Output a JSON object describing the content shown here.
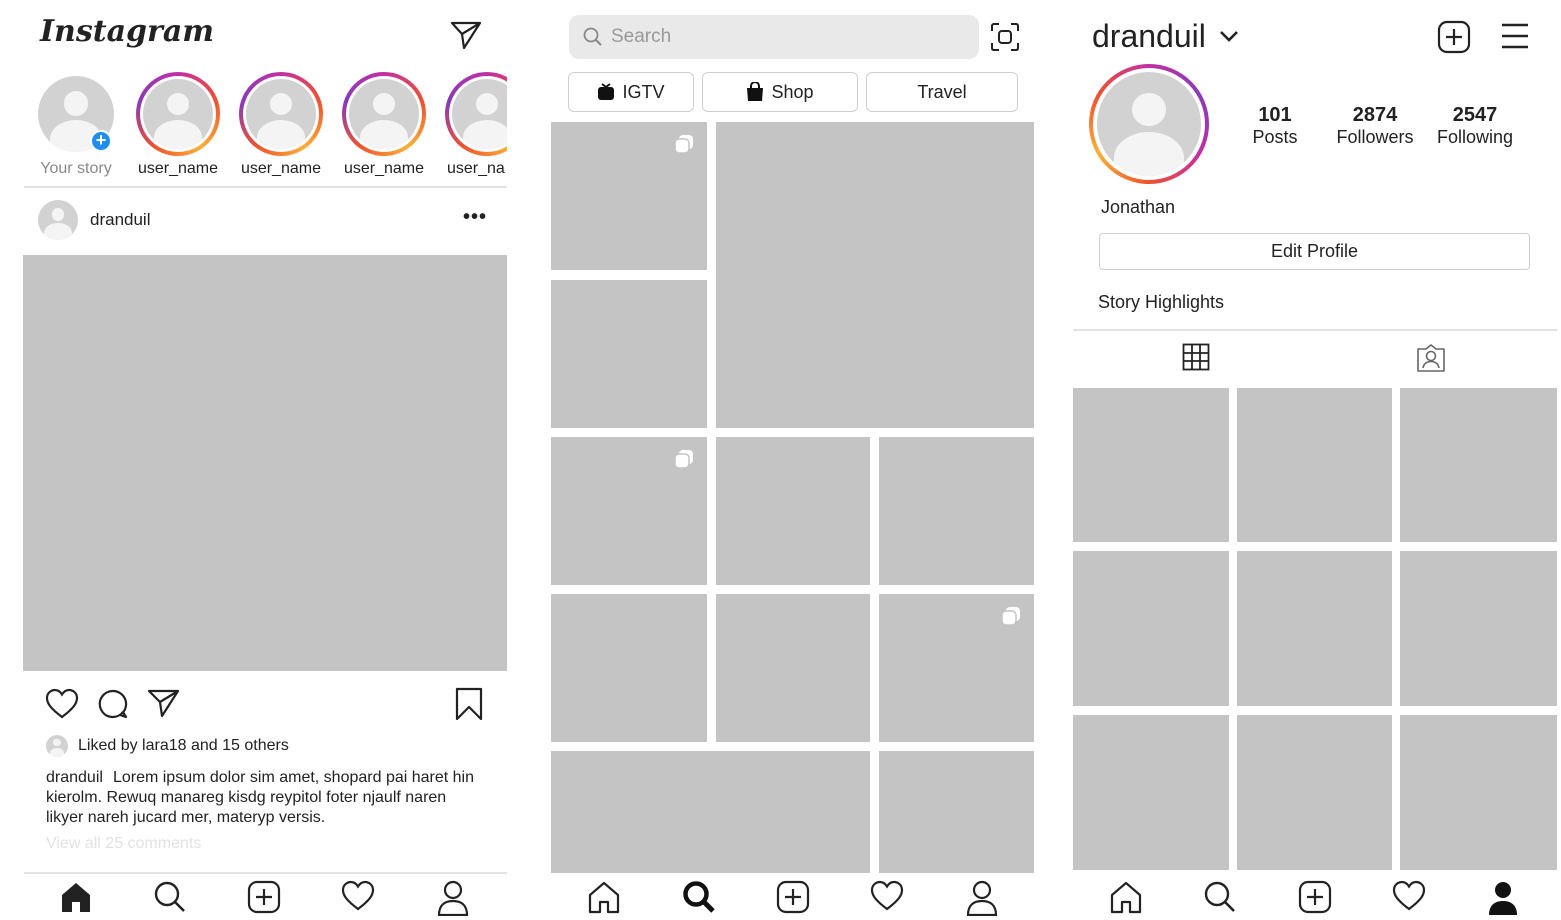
{
  "feed": {
    "logo": "Instagram",
    "stories": [
      {
        "label": "Your story",
        "own": true
      },
      {
        "label": "user_name"
      },
      {
        "label": "user_name"
      },
      {
        "label": "user_name"
      },
      {
        "label": "user_na"
      }
    ],
    "post": {
      "username": "dranduil",
      "liked_prefix": "Liked by",
      "liked_user": "lara18",
      "liked_and": "and",
      "liked_others": "15 others",
      "caption_user": "dranduil",
      "caption_text": "Lorem ipsum dolor sim amet, shopard pai haret hin kierolm. Rewuq manareg kisdg reypitol foter njaulf naren likyer nareh jucard mer, materyp versis.",
      "view_comments": "View all 25 comments"
    }
  },
  "explore": {
    "search_placeholder": "Search",
    "chips": [
      {
        "label": "IGTV",
        "icon": "igtv-icon"
      },
      {
        "label": "Shop",
        "icon": "shop-bag-icon"
      },
      {
        "label": "Travel"
      }
    ]
  },
  "profile": {
    "username": "dranduil",
    "stats": [
      {
        "value": "101",
        "label": "Posts"
      },
      {
        "value": "2874",
        "label": "Followers"
      },
      {
        "value": "2547",
        "label": "Following"
      }
    ],
    "name": "Jonathan",
    "edit_button": "Edit Profile",
    "highlights": "Story Highlights"
  },
  "colors": {
    "placeholder_gray": "#c4c4c4",
    "badge_blue": "#1f8ef1",
    "story_ring": [
      "#c22fa6",
      "#f0512d",
      "#fbb13a",
      "#8a3ab9"
    ]
  }
}
